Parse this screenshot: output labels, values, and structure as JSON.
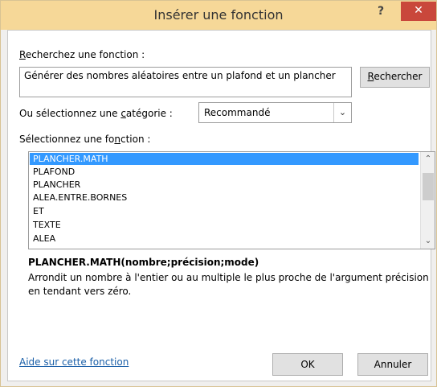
{
  "dialog": {
    "title": "Insérer une fonction",
    "help_glyph": "?",
    "close_glyph": "✕"
  },
  "search": {
    "label_prefix": "",
    "label_key": "R",
    "label_rest": "echerchez une fonction :",
    "value": "Générer des nombres aléatoires entre un plafond et un plancher",
    "button_key": "R",
    "button_rest": "echercher"
  },
  "category": {
    "label_pre": "Ou sélectionnez une ",
    "label_key": "c",
    "label_post": "atégorie :",
    "selected": "Recommandé",
    "arrow_icon": "chevron-down-icon"
  },
  "functions": {
    "label_pre": "Sélectionnez une fo",
    "label_key": "n",
    "label_post": "ction :",
    "items": [
      "PLANCHER.MATH",
      "PLAFOND",
      "PLANCHER",
      "ALEA.ENTRE.BORNES",
      "ET",
      "TEXTE",
      "ALEA"
    ],
    "selected_index": 0
  },
  "details": {
    "signature": "PLANCHER.MATH(nombre;précision;mode)",
    "description": "Arrondit un nombre à l'entier ou au multiple le plus proche de l'argument précision en tendant vers zéro."
  },
  "footer": {
    "help_link": "Aide sur cette fonction",
    "ok": "OK",
    "cancel": "Annuler"
  },
  "colors": {
    "title_bar": "#f6d898",
    "close_button": "#c9473b",
    "selection": "#3399ff",
    "link": "#1a5fa8"
  }
}
